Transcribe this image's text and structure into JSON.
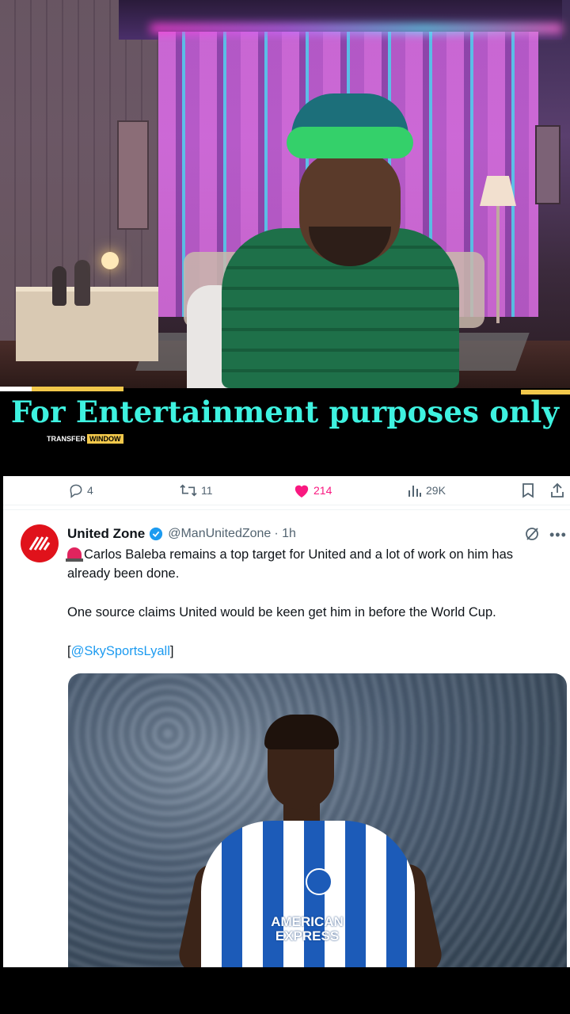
{
  "video": {
    "overlay_title": "For Entertainment purposes only",
    "badge_part1": "TRANSFER",
    "badge_part2": "WINDOW"
  },
  "tweet": {
    "actions": {
      "replies": "4",
      "retweets": "11",
      "likes": "214",
      "views": "29K"
    },
    "author_name": "United Zone",
    "author_handle": "@ManUnitedZone",
    "time": "· 1h",
    "text_line1": "Carlos Baleba remains a top target for United and a lot of work on him has already been done.",
    "text_line2": "One source claims United would be keen get him in before the World Cup.",
    "text_source_open": "[",
    "text_source_link": "@SkySportsLyall",
    "text_source_close": "]",
    "image_sponsor": "AMERICAN EXPRESS",
    "colors": {
      "like": "#f91880",
      "link": "#1d9bf0",
      "verified": "#1d9bf0",
      "overlay_text": "#3ef2e0",
      "accent_bar": "#f2c84b"
    }
  }
}
